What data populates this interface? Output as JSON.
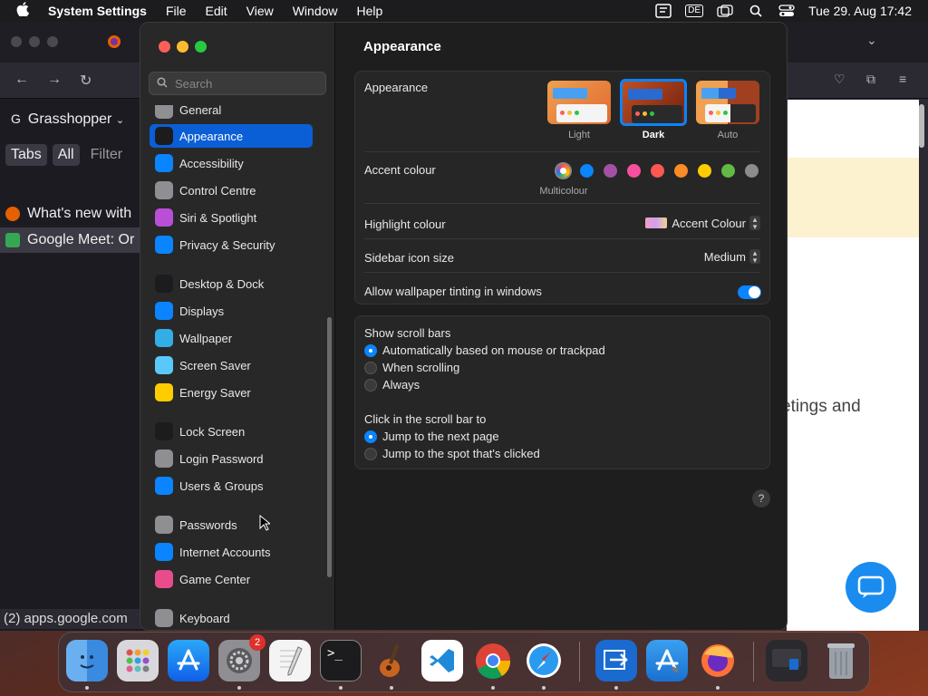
{
  "menubar": {
    "app_name": "System Settings",
    "menus": [
      "File",
      "Edit",
      "View",
      "Window",
      "Help"
    ],
    "input_source": "DE",
    "clock": "Tue 29. Aug  17:42"
  },
  "browser": {
    "group_title": "Grasshopper",
    "group_initial": "G",
    "tabs": [
      "Tabs",
      "All",
      "Filter"
    ],
    "items": [
      "What's new with",
      "Google Meet: Or"
    ],
    "status": "(2)  apps.google.com",
    "page_text": "etings and"
  },
  "sidebar": {
    "search_placeholder": "Search",
    "items": [
      {
        "label": "General",
        "color": "#8e8e93",
        "icon": "gear-icon"
      },
      {
        "label": "Appearance",
        "color": "#1c1c1e",
        "icon": "appearance-icon"
      },
      {
        "label": "Accessibility",
        "color": "#0a84ff",
        "icon": "accessibility-icon"
      },
      {
        "label": "Control Centre",
        "color": "#8e8e93",
        "icon": "control-centre-icon"
      },
      {
        "label": "Siri & Spotlight",
        "color": "#b84fd6",
        "icon": "siri-icon"
      },
      {
        "label": "Privacy & Security",
        "color": "#0a84ff",
        "icon": "hand-icon"
      },
      {
        "label": "Desktop & Dock",
        "color": "#1c1c1e",
        "icon": "dock-icon"
      },
      {
        "label": "Displays",
        "color": "#0a84ff",
        "icon": "sun-icon"
      },
      {
        "label": "Wallpaper",
        "color": "#32ade6",
        "icon": "wallpaper-icon"
      },
      {
        "label": "Screen Saver",
        "color": "#5ac8fa",
        "icon": "screen-saver-icon"
      },
      {
        "label": "Energy Saver",
        "color": "#ffcc00",
        "icon": "battery-icon"
      },
      {
        "label": "Lock Screen",
        "color": "#1c1c1e",
        "icon": "lock-icon"
      },
      {
        "label": "Login Password",
        "color": "#8e8e93",
        "icon": "lock-icon"
      },
      {
        "label": "Users & Groups",
        "color": "#0a84ff",
        "icon": "users-icon"
      },
      {
        "label": "Passwords",
        "color": "#8e8e93",
        "icon": "key-icon"
      },
      {
        "label": "Internet Accounts",
        "color": "#0a84ff",
        "icon": "at-icon"
      },
      {
        "label": "Game Center",
        "color": "#e84c8a",
        "icon": "game-center-icon"
      },
      {
        "label": "Keyboard",
        "color": "#8e8e93",
        "icon": "keyboard-icon"
      }
    ]
  },
  "content": {
    "title": "Appearance",
    "appearance": {
      "label": "Appearance",
      "options": [
        "Light",
        "Dark",
        "Auto"
      ],
      "selected": "Dark"
    },
    "accent": {
      "label": "Accent colour",
      "caption": "Multicolour",
      "colors": [
        "multicolor",
        "#0a84ff",
        "#a550a7",
        "#f74f9e",
        "#fc5753",
        "#fd8b26",
        "#fecc00",
        "#62ba46",
        "#8c8c8c"
      ]
    },
    "highlight": {
      "label": "Highlight colour",
      "value": "Accent Colour"
    },
    "icon_size": {
      "label": "Sidebar icon size",
      "value": "Medium"
    },
    "tinting": {
      "label": "Allow wallpaper tinting in windows",
      "on": true
    },
    "scroll_bars": {
      "label": "Show scroll bars",
      "options": [
        "Automatically based on mouse or trackpad",
        "When scrolling",
        "Always"
      ],
      "selected": 0
    },
    "click_scroll": {
      "label": "Click in the scroll bar to",
      "options": [
        "Jump to the next page",
        "Jump to the spot that's clicked"
      ],
      "selected": 0
    },
    "help": "?"
  },
  "dock": {
    "settings_badge": "2",
    "apps": [
      "finder",
      "launchpad",
      "app-store",
      "system-settings",
      "textedit",
      "terminal",
      "garageband",
      "vscode",
      "chrome",
      "safari",
      "migration",
      "xcode-tools",
      "firefox",
      "screenshot",
      "trash"
    ]
  }
}
